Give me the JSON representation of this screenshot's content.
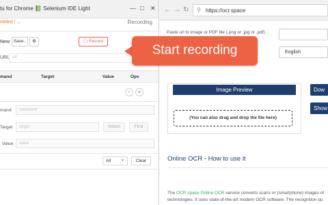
{
  "window": {
    "title": "tu for Chrome 📗 Selenium IDE Light"
  },
  "macro": {
    "name": "ntitled",
    "mode_label": "Recording"
  },
  "toolbar": {
    "new_label": "New",
    "save_label": "Save..",
    "record_label": "Record"
  },
  "url_field": {
    "label": "URL",
    "placeholder": "url"
  },
  "table": {
    "headers": [
      "mand",
      "Target",
      "Value",
      "Ops"
    ]
  },
  "editor": {
    "command_label": "mand:",
    "command_placeholder": "command",
    "target_label": "Target:",
    "target_placeholder": "target",
    "select_label": "Select",
    "find_label": "Find",
    "value_label": "Value:",
    "value_placeholder": "value"
  },
  "log": {
    "filter_value": "All",
    "clear_label": "Clear"
  },
  "browser": {
    "url": "https://ocr.space",
    "paste_label": "Paste url to image or PDF file (.png or .jpg or .pdf)",
    "language": "English",
    "preview_title": "Image Preview",
    "drop_text": "(You can also drag and drop the file here)",
    "side_buttons": [
      "Dow",
      "Show"
    ],
    "section_title": "Online OCR - How to use it",
    "para_line1_prefix": "The ",
    "para_link1": "OCR.space Online OCR",
    "para_line1_suffix": " service converts scans or (smartphone) images of",
    "para_line2": "technologies. It uses state-of-the-art modern OCR software. The recognition qu"
  },
  "callout": {
    "text": "Start recording"
  },
  "colors": {
    "accent_red": "#ee6244",
    "brand_navy": "#1d3e6e",
    "link_green": "#3aa05c"
  }
}
